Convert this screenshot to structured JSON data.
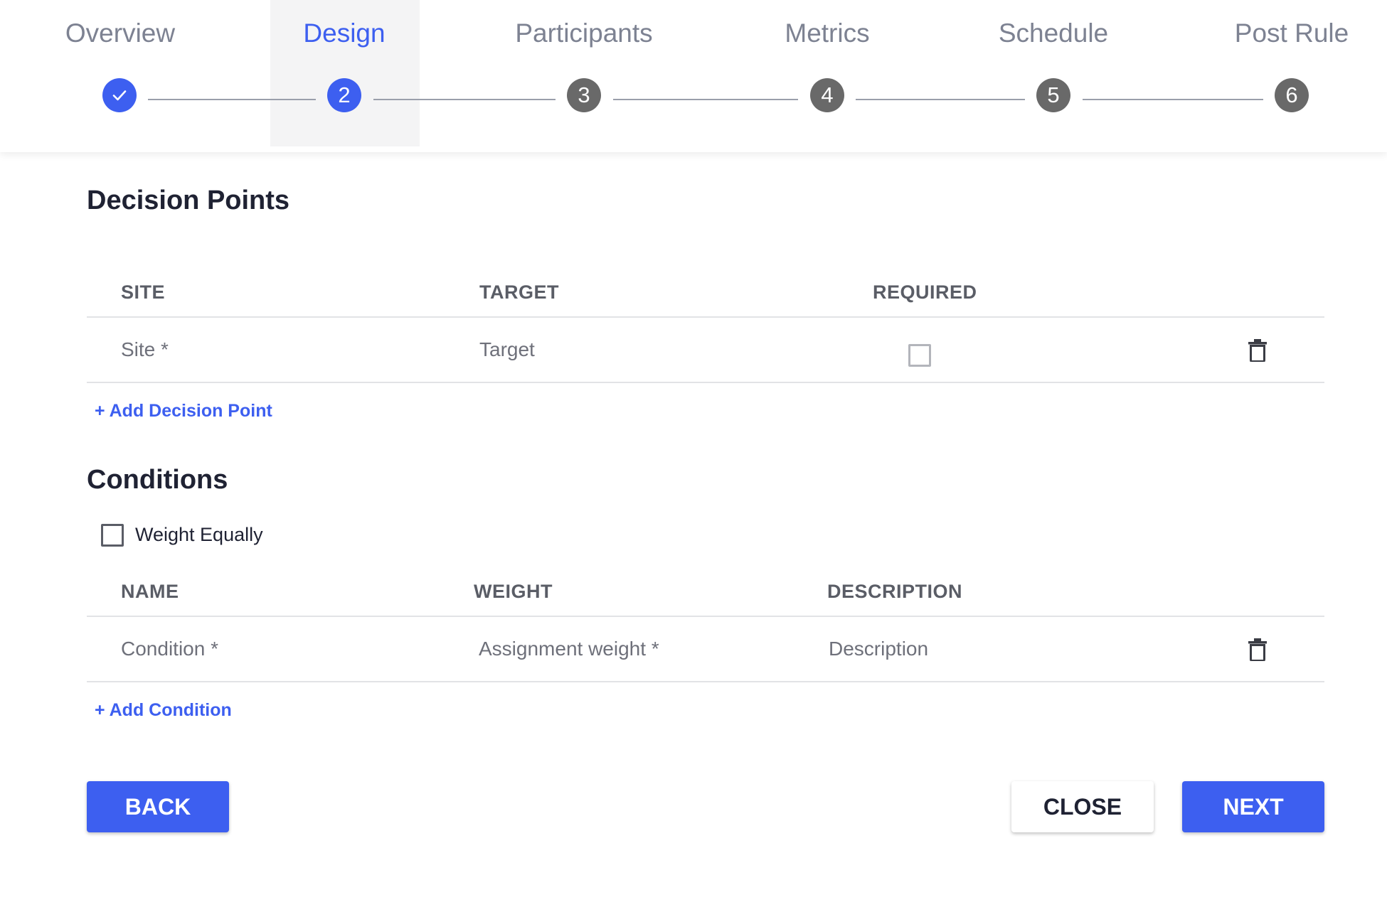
{
  "stepper": {
    "steps": [
      {
        "label": "Overview",
        "number": "",
        "status": "complete"
      },
      {
        "label": "Design",
        "number": "2",
        "status": "active"
      },
      {
        "label": "Participants",
        "number": "3",
        "status": "pending"
      },
      {
        "label": "Metrics",
        "number": "4",
        "status": "pending"
      },
      {
        "label": "Schedule",
        "number": "5",
        "status": "pending"
      },
      {
        "label": "Post Rule",
        "number": "6",
        "status": "pending"
      }
    ]
  },
  "decision_points": {
    "title": "Decision Points",
    "columns": {
      "site": "SITE",
      "target": "TARGET",
      "required": "REQUIRED"
    },
    "row": {
      "site_placeholder": "Site *",
      "target_placeholder": "Target"
    },
    "add_label": "+ Add Decision Point"
  },
  "conditions": {
    "title": "Conditions",
    "weight_equally_label": "Weight Equally",
    "columns": {
      "name": "NAME",
      "weight": "WEIGHT",
      "description": "DESCRIPTION"
    },
    "row": {
      "name_placeholder": "Condition *",
      "weight_placeholder": "Assignment weight *",
      "description_placeholder": "Description"
    },
    "add_label": "+ Add Condition"
  },
  "footer": {
    "back_label": "BACK",
    "close_label": "CLOSE",
    "next_label": "NEXT"
  },
  "colors": {
    "accent": "#3d5ff0",
    "step_pending": "#696969",
    "text_dark": "#1f2233"
  }
}
